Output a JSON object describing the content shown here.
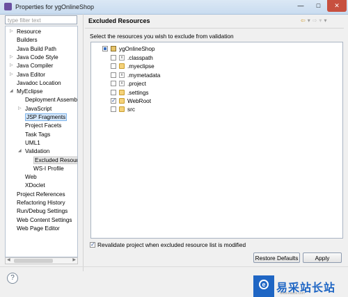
{
  "window": {
    "title": "Properties for ygOnlineShop",
    "minimize": "—",
    "maximize": "□",
    "close": "✕"
  },
  "filter": {
    "placeholder": "type filter text"
  },
  "tree": {
    "items": [
      {
        "label": "Resource",
        "twisty": "▷"
      },
      {
        "label": "Builders",
        "twisty": ""
      },
      {
        "label": "Java Build Path",
        "twisty": ""
      },
      {
        "label": "Java Code Style",
        "twisty": "▷"
      },
      {
        "label": "Java Compiler",
        "twisty": "▷"
      },
      {
        "label": "Java Editor",
        "twisty": "▷"
      },
      {
        "label": "Javadoc Location",
        "twisty": ""
      },
      {
        "label": "MyEclipse",
        "twisty": "◢"
      },
      {
        "label": "Deployment Assembl",
        "twisty": ""
      },
      {
        "label": "JavaScript",
        "twisty": "▷"
      },
      {
        "label": "JSP Fragments",
        "twisty": ""
      },
      {
        "label": "Project Facets",
        "twisty": ""
      },
      {
        "label": "Task Tags",
        "twisty": ""
      },
      {
        "label": "UML1",
        "twisty": ""
      },
      {
        "label": "Validation",
        "twisty": "◢"
      },
      {
        "label": "Excluded Resourc",
        "twisty": ""
      },
      {
        "label": "WS-I Profile",
        "twisty": ""
      },
      {
        "label": "Web",
        "twisty": ""
      },
      {
        "label": "XDoclet",
        "twisty": ""
      },
      {
        "label": "Project References",
        "twisty": ""
      },
      {
        "label": "Refactoring History",
        "twisty": ""
      },
      {
        "label": "Run/Debug Settings",
        "twisty": ""
      },
      {
        "label": "Web Content Settings",
        "twisty": ""
      },
      {
        "label": "Web Page Editor",
        "twisty": ""
      }
    ]
  },
  "page": {
    "title": "Excluded Resources",
    "description": "Select the resources you wish to exclude from validation",
    "nav": {
      "back": "⇦",
      "back_menu": "▾",
      "forward": "⇨",
      "forward_menu": "▾",
      "view_menu": "▾"
    }
  },
  "resources": {
    "project": "ygOnlineShop",
    "items": [
      {
        "label": ".classpath",
        "type": "file",
        "checked": false
      },
      {
        "label": ".myeclipse",
        "type": "folder",
        "checked": false
      },
      {
        "label": ".mymetadata",
        "type": "file",
        "checked": false
      },
      {
        "label": ".project",
        "type": "file",
        "checked": false
      },
      {
        "label": ".settings",
        "type": "folder",
        "checked": false
      },
      {
        "label": "WebRoot",
        "type": "folder",
        "checked": true
      },
      {
        "label": "src",
        "type": "folder",
        "checked": false
      }
    ]
  },
  "revalidate": {
    "label": "Revalidate project when excluded resource list is modified",
    "checked": true
  },
  "buttons": {
    "restore_defaults": "Restore Defaults",
    "apply": "Apply"
  },
  "help": {
    "icon": "?"
  },
  "watermark": {
    "text": "易采站长站",
    "url": "www.easck.com",
    "badge": "e"
  },
  "colors": {
    "accent": "#1f66c4",
    "selection": "#d6e8fb"
  }
}
